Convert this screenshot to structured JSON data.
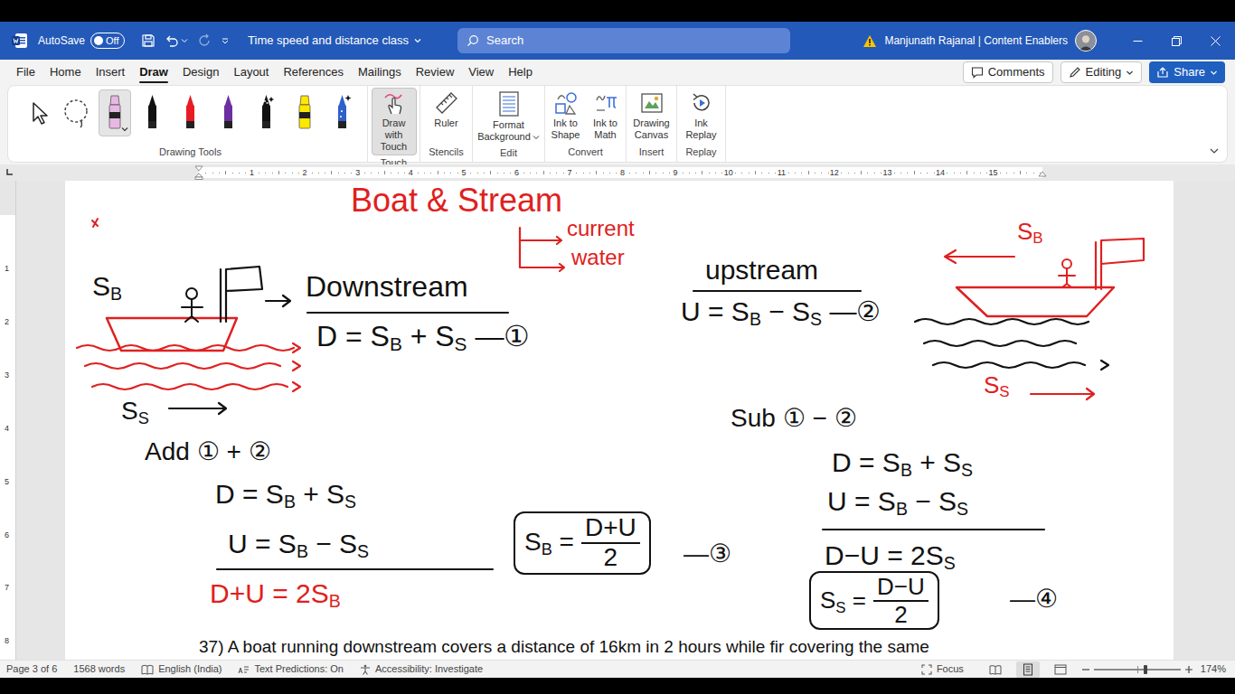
{
  "window": {
    "title": "Time speed and distance class"
  },
  "title_bar": {
    "autosave": "AutoSave",
    "autosave_state": "Off",
    "autosave_on": false,
    "search": {
      "placeholder": "Search"
    },
    "user": "Manjunath Rajanal | Content Enablers"
  },
  "menu": {
    "tabs": [
      {
        "label": "File",
        "selected": false
      },
      {
        "label": "Home",
        "selected": false
      },
      {
        "label": "Insert",
        "selected": false
      },
      {
        "label": "Draw",
        "selected": true
      },
      {
        "label": "Design",
        "selected": false
      },
      {
        "label": "Layout",
        "selected": false
      },
      {
        "label": "References",
        "selected": false
      },
      {
        "label": "Mailings",
        "selected": false
      },
      {
        "label": "Review",
        "selected": false
      },
      {
        "label": "View",
        "selected": false
      },
      {
        "label": "Help",
        "selected": false
      }
    ],
    "buttons": [
      {
        "label": "Comments"
      },
      {
        "label": "Editing"
      },
      {
        "label": "Share"
      }
    ]
  },
  "ribbon": {
    "tools": [
      {
        "kind": "select",
        "selected": false
      },
      {
        "kind": "lasso",
        "selected": false
      },
      {
        "kind": "highlighter",
        "color": "#e7b8e3",
        "selected": true
      },
      {
        "kind": "pen",
        "color": "#111111",
        "selected": false
      },
      {
        "kind": "pen",
        "color": "#e81b23",
        "selected": false
      },
      {
        "kind": "pen",
        "color": "#6b2fa0",
        "selected": false
      },
      {
        "kind": "glitter",
        "color": "#111111",
        "selected": false
      },
      {
        "kind": "highlighter",
        "color": "#ffe800",
        "selected": false
      },
      {
        "kind": "galaxy",
        "color": "#2f5fc9",
        "selected": false
      }
    ],
    "tools_label": "Drawing Tools",
    "groups": [
      {
        "label": "Touch",
        "buttons": [
          {
            "label": "Draw with Touch",
            "kind": "touch",
            "selected": true
          }
        ]
      },
      {
        "label": "Stencils",
        "buttons": [
          {
            "label": "Ruler",
            "kind": "ruler",
            "selected": false
          }
        ]
      },
      {
        "label": "Edit",
        "buttons": [
          {
            "label": "Format Background",
            "kind": "background",
            "selected": false
          }
        ]
      },
      {
        "label": "Convert",
        "buttons": [
          {
            "label": "Ink to Shape",
            "kind": "shape",
            "selected": false
          },
          {
            "label": "Ink to Math",
            "kind": "math",
            "selected": false
          }
        ]
      },
      {
        "label": "Insert",
        "buttons": [
          {
            "label": "Drawing Canvas",
            "kind": "canvas",
            "selected": false
          }
        ]
      },
      {
        "label": "Replay",
        "buttons": [
          {
            "label": "Ink Replay",
            "kind": "replay",
            "selected": false
          }
        ]
      }
    ]
  },
  "ruler": {
    "ticks": [
      "1",
      "2",
      "3",
      "4",
      "5",
      "6",
      "7",
      "8",
      "9",
      "10",
      "11",
      "12",
      "13",
      "14",
      "15"
    ]
  },
  "vertical_ruler": {
    "ticks": [
      "1",
      "2",
      "3",
      "4",
      "5",
      "6",
      "7",
      "8"
    ]
  },
  "document": {
    "ink": [
      {
        "kind": "line",
        "color": "#e02020",
        "parts": [
          {
            "t": "Boat & Stream",
            "sub": false
          }
        ]
      },
      {
        "kind": "line",
        "color": "#e02020",
        "parts": [
          {
            "t": "current",
            "sub": false
          }
        ]
      },
      {
        "kind": "line",
        "color": "#e02020",
        "parts": [
          {
            "t": "water",
            "sub": false
          }
        ]
      },
      {
        "kind": "line",
        "color": "#111111",
        "parts": [
          {
            "t": "S",
            "sub": false
          },
          {
            "t": "B",
            "sub": true
          }
        ]
      },
      {
        "kind": "line",
        "color": "#111111",
        "parts": [
          {
            "t": "Downstream",
            "sub": false
          }
        ]
      },
      {
        "kind": "line",
        "color": "#111111",
        "parts": [
          {
            "t": "D = S",
            "sub": false
          },
          {
            "t": "B",
            "sub": true
          },
          {
            "t": " + S",
            "sub": false
          },
          {
            "t": "S",
            "sub": true
          },
          {
            "t": " —①",
            "sub": false
          }
        ]
      },
      {
        "kind": "line",
        "color": "#111111",
        "parts": [
          {
            "t": "S",
            "sub": false
          },
          {
            "t": "S",
            "sub": true
          }
        ]
      },
      {
        "kind": "line",
        "color": "#111111",
        "parts": [
          {
            "t": "upstream",
            "sub": false
          }
        ]
      },
      {
        "kind": "line",
        "color": "#111111",
        "parts": [
          {
            "t": "U = S",
            "sub": false
          },
          {
            "t": "B",
            "sub": true
          },
          {
            "t": " − S",
            "sub": false
          },
          {
            "t": "S",
            "sub": true
          },
          {
            "t": " —②",
            "sub": false
          }
        ]
      },
      {
        "kind": "line",
        "color": "#e02020",
        "parts": [
          {
            "t": "S",
            "sub": false
          },
          {
            "t": "B",
            "sub": true
          }
        ]
      },
      {
        "kind": "line",
        "color": "#e02020",
        "parts": [
          {
            "t": "S",
            "sub": false
          },
          {
            "t": "S",
            "sub": true
          }
        ]
      },
      {
        "kind": "line",
        "color": "#111111",
        "parts": [
          {
            "t": "Add ① + ②",
            "sub": false
          }
        ]
      },
      {
        "kind": "line",
        "color": "#111111",
        "parts": [
          {
            "t": "D = S",
            "sub": false
          },
          {
            "t": "B",
            "sub": true
          },
          {
            "t": " + S",
            "sub": false
          },
          {
            "t": "S",
            "sub": true
          }
        ]
      },
      {
        "kind": "line",
        "color": "#111111",
        "parts": [
          {
            "t": "U = S",
            "sub": false
          },
          {
            "t": "B",
            "sub": true
          },
          {
            "t": " − S",
            "sub": false
          },
          {
            "t": "S",
            "sub": true
          }
        ]
      },
      {
        "kind": "line",
        "color": "#e02020",
        "parts": [
          {
            "t": "D+U = 2S",
            "sub": false
          },
          {
            "t": "B",
            "sub": true
          }
        ]
      },
      {
        "kind": "fraction",
        "color": "#111111",
        "parts": [
          {
            "t": "S",
            "sub": false
          },
          {
            "t": "B",
            "sub": true
          },
          {
            "t": " =",
            "sub": false
          }
        ],
        "num": "D+U",
        "den": "2"
      },
      {
        "kind": "line",
        "color": "#111111",
        "parts": [
          {
            "t": "—③",
            "sub": false
          }
        ]
      },
      {
        "kind": "line",
        "color": "#111111",
        "parts": [
          {
            "t": "Sub ① − ②",
            "sub": false
          }
        ]
      },
      {
        "kind": "line",
        "color": "#111111",
        "parts": [
          {
            "t": "D = S",
            "sub": false
          },
          {
            "t": "B",
            "sub": true
          },
          {
            "t": " + S",
            "sub": false
          },
          {
            "t": "S",
            "sub": true
          }
        ]
      },
      {
        "kind": "line",
        "color": "#111111",
        "parts": [
          {
            "t": "U = S",
            "sub": false
          },
          {
            "t": "B",
            "sub": true
          },
          {
            "t": " − S",
            "sub": false
          },
          {
            "t": "S",
            "sub": true
          }
        ]
      },
      {
        "kind": "line",
        "color": "#111111",
        "parts": [
          {
            "t": "D−U = 2S",
            "sub": false
          },
          {
            "t": "S",
            "sub": true
          }
        ]
      },
      {
        "kind": "fraction",
        "color": "#111111",
        "parts": [
          {
            "t": "S",
            "sub": false
          },
          {
            "t": "S",
            "sub": true
          },
          {
            "t": " =",
            "sub": false
          }
        ],
        "num": "D−U",
        "den": "2"
      },
      {
        "kind": "line",
        "color": "#111111",
        "parts": [
          {
            "t": "—④",
            "sub": false
          }
        ]
      }
    ],
    "paragraph": "37) A boat running downstream covers a distance of 16km in 2 hours while fir covering the same"
  },
  "status_bar": {
    "items": [
      {
        "text": "Page 3 of 6"
      },
      {
        "text": "1568 words"
      },
      {
        "text": "English (India)"
      },
      {
        "text": "Text Predictions: On"
      },
      {
        "text": "Accessibility: Investigate"
      }
    ],
    "focus": "Focus",
    "views": [
      {
        "selected": false
      },
      {
        "selected": true
      },
      {
        "selected": false
      }
    ],
    "zoom": "174%",
    "zoom_level": 0.6
  }
}
